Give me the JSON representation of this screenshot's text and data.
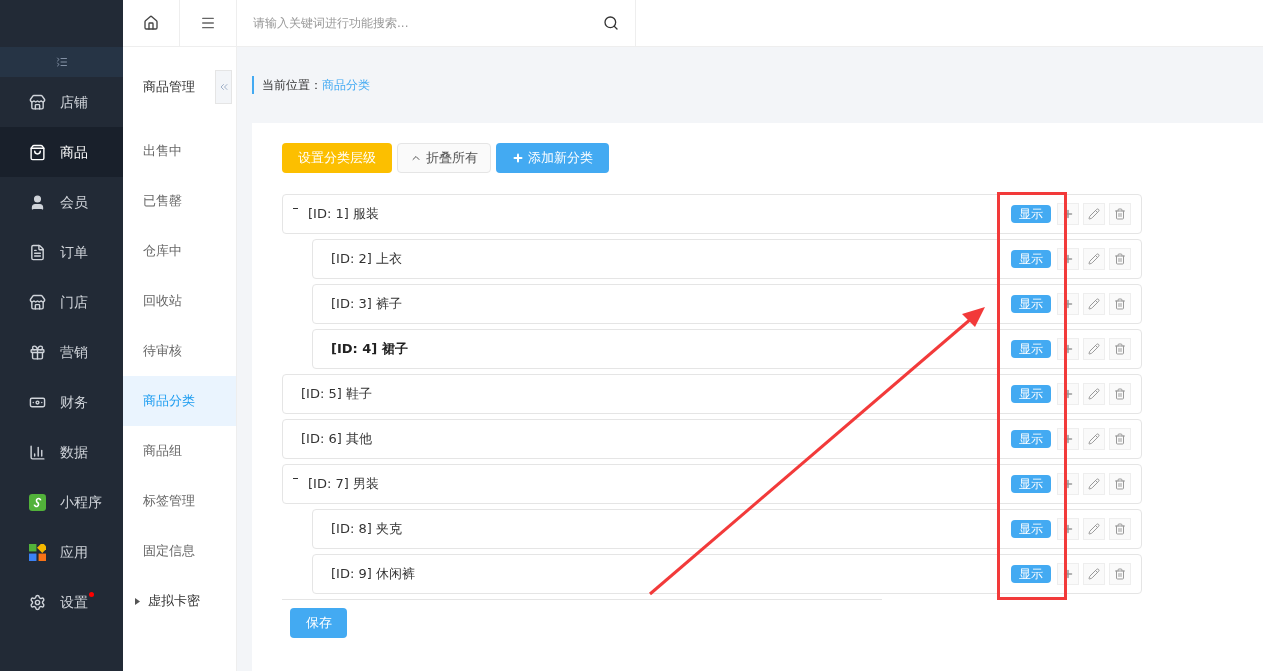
{
  "main_nav": [
    {
      "label": "店铺",
      "selected": false
    },
    {
      "label": "商品",
      "selected": true
    },
    {
      "label": "会员",
      "selected": false
    },
    {
      "label": "订单",
      "selected": false
    },
    {
      "label": "门店",
      "selected": false
    },
    {
      "label": "营销",
      "selected": false
    },
    {
      "label": "财务",
      "selected": false
    },
    {
      "label": "数据",
      "selected": false
    },
    {
      "label": "小程序",
      "selected": false
    },
    {
      "label": "应用",
      "selected": false
    },
    {
      "label": "设置",
      "selected": false,
      "badge_dot": true
    }
  ],
  "sub_nav": {
    "title": "商品管理",
    "items": [
      {
        "label": "出售中",
        "selected": false
      },
      {
        "label": "已售罄",
        "selected": false
      },
      {
        "label": "仓库中",
        "selected": false
      },
      {
        "label": "回收站",
        "selected": false
      },
      {
        "label": "待审核",
        "selected": false
      },
      {
        "label": "商品分类",
        "selected": true
      },
      {
        "label": "商品组",
        "selected": false
      },
      {
        "label": "标签管理",
        "selected": false
      },
      {
        "label": "固定信息",
        "selected": false
      },
      {
        "label": "虚拟卡密",
        "selected": false,
        "kind": "group"
      }
    ]
  },
  "search": {
    "placeholder": "请输入关键词进行功能搜索..."
  },
  "breadcrumb": {
    "label": "当前位置：",
    "current": "商品分类"
  },
  "toolbar": [
    {
      "label": "设置分类层级",
      "kind": "warning"
    },
    {
      "label": "折叠所有",
      "kind": "collapse"
    },
    {
      "label": "添加新分类",
      "kind": "add"
    }
  ],
  "tree": [
    {
      "label": "[ID: 1] 服装",
      "status": "显示",
      "selected": false,
      "expanded": true,
      "children": [
        {
          "label": "[ID: 2] 上衣",
          "status": "显示",
          "selected": false
        },
        {
          "label": "[ID: 3] 裤子",
          "status": "显示",
          "selected": false
        },
        {
          "label": "[ID: 4] 裙子",
          "status": "显示",
          "selected": true
        }
      ]
    },
    {
      "label": "[ID: 5] 鞋子",
      "status": "显示",
      "selected": false
    },
    {
      "label": "[ID: 6] 其他",
      "status": "显示",
      "selected": false
    },
    {
      "label": "[ID: 7] 男装",
      "status": "显示",
      "selected": false,
      "expanded": true,
      "children": [
        {
          "label": "[ID: 8] 夹克",
          "status": "显示",
          "selected": false
        },
        {
          "label": "[ID: 9] 休闲裤",
          "status": "显示",
          "selected": false
        }
      ]
    }
  ],
  "save_button": "保存"
}
